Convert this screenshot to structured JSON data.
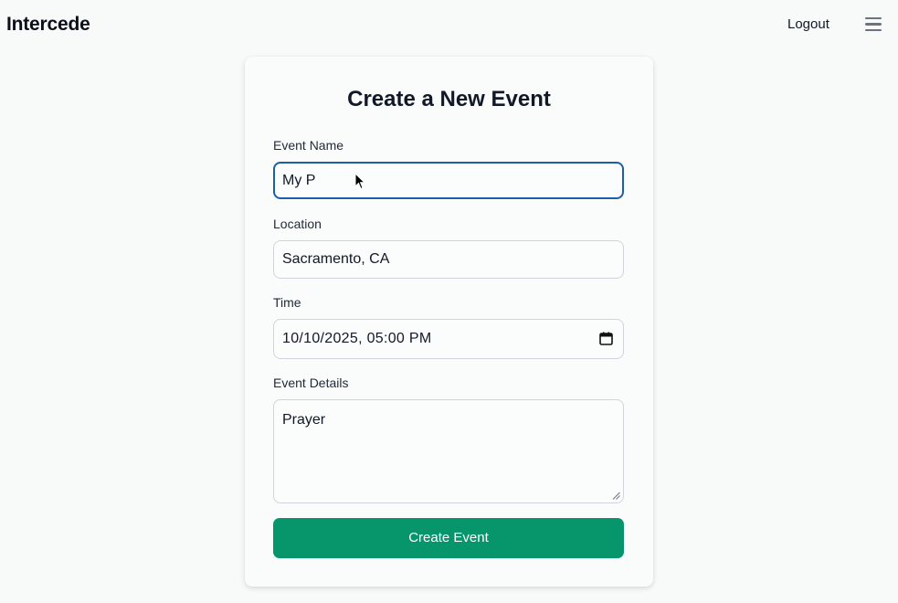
{
  "navbar": {
    "brand": "Intercede",
    "logout_label": "Logout",
    "menu_icon": "hamburger-menu-icon"
  },
  "form": {
    "title": "Create a New Event",
    "event_name": {
      "label": "Event Name",
      "value": "My P"
    },
    "location": {
      "label": "Location",
      "value": "Sacramento, CA"
    },
    "time": {
      "label": "Time",
      "value": "10/10/2025, 05:00 PM",
      "icon": "calendar-icon"
    },
    "details": {
      "label": "Event Details",
      "value": "Prayer"
    },
    "submit_label": "Create Event"
  },
  "colors": {
    "accent": "#07966b",
    "focus_border": "#1d5ea8",
    "background": "#f8faf9"
  }
}
